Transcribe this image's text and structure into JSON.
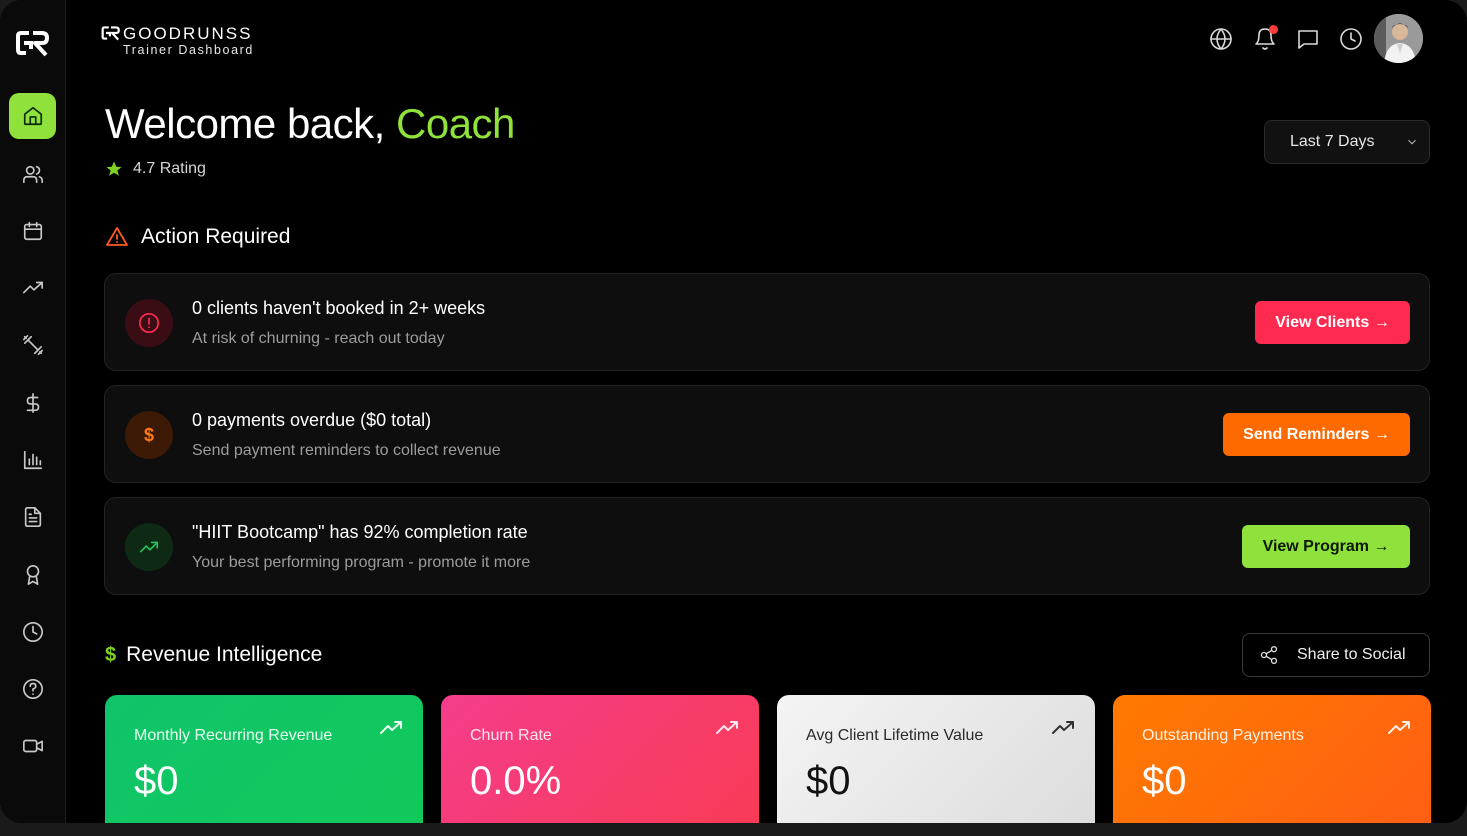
{
  "brand": {
    "name": "GOODRUNSS",
    "subtitle": "Trainer Dashboard"
  },
  "sidebar": {
    "items": [
      {
        "name": "home",
        "icon": "home-icon",
        "active": true
      },
      {
        "name": "clients",
        "icon": "users-icon"
      },
      {
        "name": "calendar",
        "icon": "calendar-icon"
      },
      {
        "name": "trends",
        "icon": "trending-up-icon"
      },
      {
        "name": "workouts",
        "icon": "dumbbell-icon"
      },
      {
        "name": "payments",
        "icon": "dollar-icon"
      },
      {
        "name": "analytics",
        "icon": "bar-chart-icon"
      },
      {
        "name": "documents",
        "icon": "document-icon"
      },
      {
        "name": "achievements",
        "icon": "award-icon"
      },
      {
        "name": "history",
        "icon": "clock-icon"
      },
      {
        "name": "help",
        "icon": "help-icon"
      },
      {
        "name": "video",
        "icon": "video-icon"
      }
    ]
  },
  "header": {
    "icons": [
      "globe-icon",
      "bell-icon",
      "message-icon",
      "clock-icon"
    ],
    "has_notification": true
  },
  "welcome": {
    "prefix": "Welcome back, ",
    "name": "Coach",
    "rating": "4.7 Rating"
  },
  "date_range": {
    "selected": "Last 7 Days"
  },
  "action_required": {
    "title": "Action Required",
    "cards": [
      {
        "title": "0 clients haven't booked in 2+ weeks",
        "subtitle": "At risk of churning - reach out today",
        "button": "View Clients →",
        "accent": "#ff2a4f",
        "icon": "alert-circle-icon"
      },
      {
        "title": "0 payments overdue ($0 total)",
        "subtitle": "Send payment reminders to collect revenue",
        "button": "Send Reminders →",
        "accent": "#ff6a00",
        "icon": "dollar-icon",
        "icon_glyph": "$"
      },
      {
        "title": "\"HIIT Bootcamp\" has 92% completion rate",
        "subtitle": "Your best performing program - promote it more",
        "button": "View Program →",
        "accent": "#8fe13b",
        "icon": "trending-up-icon"
      }
    ]
  },
  "revenue": {
    "title_glyph": "$",
    "title": "Revenue Intelligence",
    "share_label": "Share to Social",
    "metrics": [
      {
        "label": "Monthly Recurring Revenue",
        "value": "$0",
        "colors": [
          "#0fc46a",
          "#11c95a"
        ]
      },
      {
        "label": "Churn Rate",
        "value": "0.0%",
        "colors": [
          "#f53d8b",
          "#f93b55"
        ]
      },
      {
        "label": "Avg Client Lifetime Value",
        "value": "$0",
        "colors": [
          "#f4f4f4",
          "#dcdcdc"
        ]
      },
      {
        "label": "Outstanding Payments",
        "value": "$0",
        "colors": [
          "#ff7a00",
          "#ff5e14"
        ]
      }
    ]
  }
}
